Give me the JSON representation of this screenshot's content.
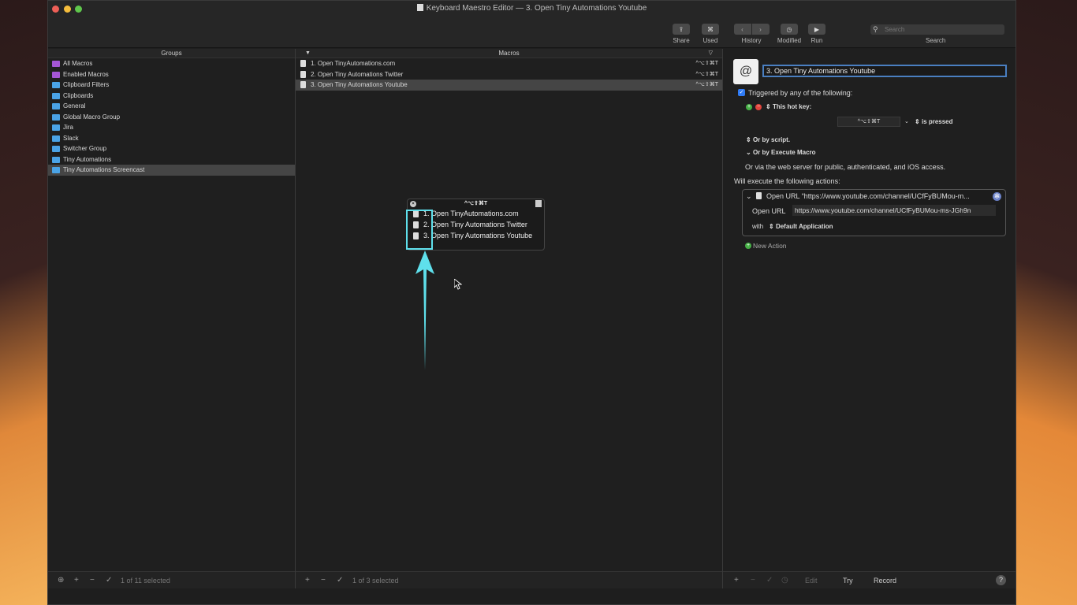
{
  "window": {
    "title": "Keyboard Maestro Editor — 3. Open Tiny Automations Youtube"
  },
  "toolbar": {
    "share": "Share",
    "used": "Used",
    "history": "History",
    "modified": "Modified",
    "run": "Run",
    "search_label": "Search",
    "search_placeholder": "Search"
  },
  "groups": {
    "header": "Groups",
    "items": [
      {
        "label": "All Macros",
        "color": "#a456d6"
      },
      {
        "label": "Enabled Macros",
        "color": "#a456d6"
      },
      {
        "label": "Clipboard Filters",
        "color": "#4aa3e6"
      },
      {
        "label": "Clipboards",
        "color": "#4aa3e6"
      },
      {
        "label": "General",
        "color": "#4aa3e6"
      },
      {
        "label": "Global Macro Group",
        "color": "#4aa3e6"
      },
      {
        "label": "Jira",
        "color": "#4aa3e6"
      },
      {
        "label": "Slack",
        "color": "#4aa3e6"
      },
      {
        "label": "Switcher Group",
        "color": "#4aa3e6"
      },
      {
        "label": "Tiny Automations",
        "color": "#4aa3e6"
      },
      {
        "label": "Tiny Automations Screencast",
        "color": "#4aa3e6"
      }
    ],
    "footer_status": "1 of 11 selected"
  },
  "macros": {
    "header": "Macros",
    "items": [
      {
        "label": "1. Open TinyAutomations.com",
        "hotkey": "^⌥⇧⌘T"
      },
      {
        "label": "2. Open Tiny Automations Twitter",
        "hotkey": "^⌥⇧⌘T"
      },
      {
        "label": "3. Open Tiny Automations Youtube",
        "hotkey": "^⌥⇧⌘T"
      }
    ],
    "footer_status": "1 of 3 selected"
  },
  "popup": {
    "title": "^⌥⇧⌘T",
    "items": [
      "1. Open TinyAutomations.com",
      "2. Open Tiny Automations Twitter",
      "3. Open Tiny Automations Youtube"
    ]
  },
  "editor": {
    "macro_name": "3. Open Tiny Automations Youtube",
    "triggered_label": "Triggered by any of the following:",
    "hotkey_label": "This hot key:",
    "hotkey_value": "^⌥⇧⌘T",
    "pressed_label": "is pressed",
    "script_label": "Or by script.",
    "execute_label": "Or by Execute Macro",
    "web_label": "Or via the web server for public, authenticated, and iOS access.",
    "will_execute": "Will execute the following actions:",
    "action": {
      "title": "Open URL “https://www.youtube.com/channel/UCfFyBUMou-m...",
      "url_label": "Open URL",
      "url_value": "https://www.youtube.com/channel/UCfFyBUMou-ms-JGh9n",
      "with_label": "with",
      "app": "Default Application"
    },
    "new_action": "New Action",
    "footer": {
      "edit": "Edit",
      "try": "Try",
      "record": "Record",
      "help": "?"
    }
  }
}
